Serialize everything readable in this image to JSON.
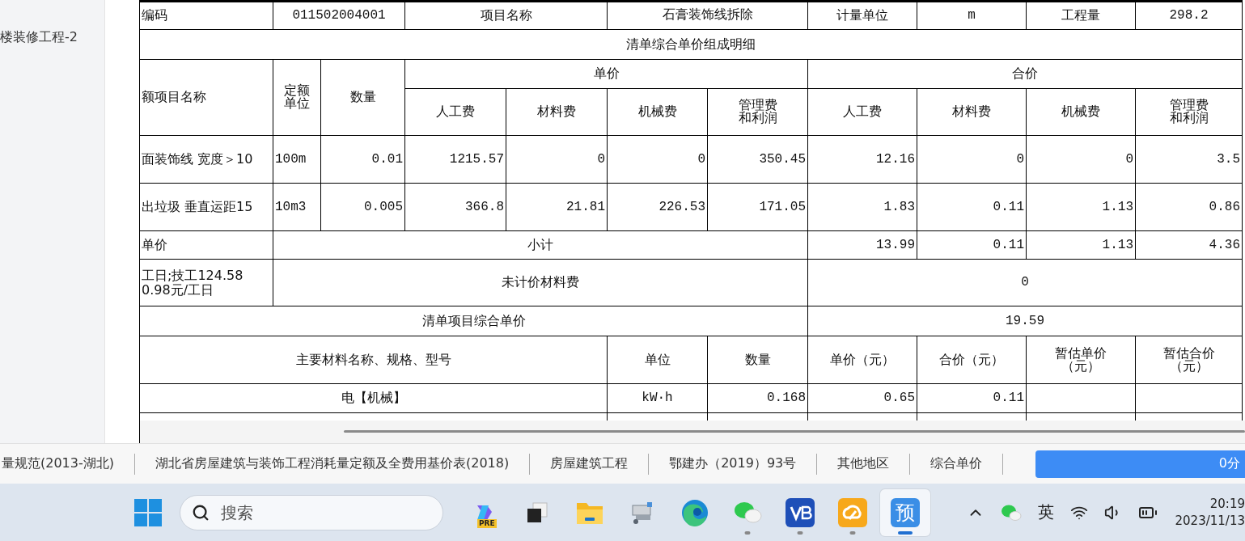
{
  "sidebar": {
    "items": [
      "楼装修工程-2"
    ]
  },
  "table": {
    "item_row": [
      {
        "kind": "label",
        "text": "编码"
      },
      {
        "kind": "value",
        "text": "011502004001"
      },
      {
        "kind": "label",
        "text": "项目名称"
      },
      {
        "kind": "value",
        "text": "石膏装饰线拆除"
      },
      {
        "kind": "label",
        "text": "计量单位"
      },
      {
        "kind": "value",
        "text": "m"
      },
      {
        "kind": "label",
        "text": "工程量"
      },
      {
        "kind": "value",
        "text": "298.2"
      }
    ],
    "section_title": "清单综合单价组成明细",
    "detail_columns": {
      "name": "额项目名称",
      "unit": "定额单位",
      "quantity": "数量",
      "unit_price": "单价",
      "total_price": "合价",
      "price_parts": [
        "人工费",
        "材料费",
        "机械费",
        "管理费和利润"
      ],
      "total_parts": [
        "人工费",
        "材料费",
        "机械费",
        "管理费和利润"
      ]
    },
    "detail_rows": [
      {
        "name": "面装饰线 宽度＞10",
        "unit": "100m",
        "quantity": "0.01",
        "unit_prices": [
          "1215.57",
          "0",
          "0",
          "350.45"
        ],
        "totals": [
          "12.16",
          "0",
          "0",
          "3.5"
        ]
      },
      {
        "name": "出垃圾 垂直运距15",
        "unit": "10m3",
        "quantity": "0.005",
        "unit_prices": [
          "366.8",
          "21.81",
          "226.53",
          "171.05"
        ],
        "totals": [
          "1.83",
          "0.11",
          "1.13",
          "0.86"
        ]
      }
    ],
    "subtotal": {
      "label": "单价",
      "caption": "小计",
      "values": [
        "13.99",
        "0.11",
        "1.13",
        "4.36"
      ]
    },
    "unpriced": {
      "note": [
        "工日;技工124.58",
        "0.98元/工日"
      ],
      "caption": "未计价材料费",
      "value": "0"
    },
    "composite": {
      "caption": "清单项目综合单价",
      "value": "19.59"
    },
    "material_columns": [
      "主要材料名称、规格、型号",
      "单位",
      "数量",
      "单价（元）",
      "合价（元）",
      "暂估单价（元）",
      "暂估合价（元）"
    ],
    "materials": [
      {
        "name": "电【机械】",
        "unit": "kW·h",
        "quantity": "0.168",
        "unit_price": "0.65",
        "total": "0.11"
      }
    ]
  },
  "status_bar": {
    "items": [
      "量规范(2013-湖北)",
      "湖北省房屋建筑与装饰工程消耗量定额及全费用基价表(2018)",
      "房屋建筑工程",
      "鄂建办（2019）93号",
      "其他地区",
      "综合单价"
    ],
    "button": "0分"
  },
  "taskbar": {
    "search_placeholder": "搜索",
    "apps": [
      {
        "kind": "copilot",
        "badge": "PRE",
        "running": false,
        "selected": false
      },
      {
        "kind": "taskview",
        "running": false,
        "selected": false
      },
      {
        "kind": "explorer",
        "running": false,
        "selected": false
      },
      {
        "kind": "tool",
        "running": false,
        "selected": false
      },
      {
        "kind": "edge",
        "running": false,
        "selected": false
      },
      {
        "kind": "wechat",
        "running": true,
        "selected": false
      },
      {
        "kind": "vb",
        "running": true,
        "selected": false
      },
      {
        "kind": "cloud",
        "running": true,
        "selected": false
      },
      {
        "kind": "letter",
        "label": "预",
        "running": true,
        "selected": true
      }
    ],
    "tray": {
      "input_mode": "英",
      "time": "20:19",
      "date": "2023/11/13"
    }
  }
}
